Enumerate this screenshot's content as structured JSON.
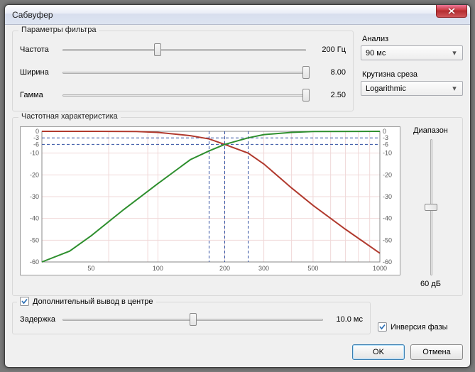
{
  "window": {
    "title": "Сабвуфер"
  },
  "filter": {
    "group": "Параметры фильтра",
    "freq_label": "Частота",
    "freq_value": "200 Гц",
    "freq_pos": 39,
    "width_label": "Ширина",
    "width_value": "8.00",
    "width_pos": 100,
    "gamma_label": "Гамма",
    "gamma_value": "2.50",
    "gamma_pos": 100
  },
  "analysis": {
    "label": "Анализ",
    "value": "90 мс"
  },
  "slope": {
    "label": "Крутизна среза",
    "value": "Logarithmic"
  },
  "response": {
    "group": "Частотная характеристика"
  },
  "range": {
    "label": "Диапазон",
    "value": "60 дБ",
    "pos": 50
  },
  "delay": {
    "chk_label": "Дополнительный вывод в центре",
    "chk_checked": true,
    "label": "Задержка",
    "value": "10.0 мс",
    "pos": 50
  },
  "invert": {
    "label": "Инверсия фазы",
    "checked": true
  },
  "buttons": {
    "ok": "OK",
    "cancel": "Отмена"
  },
  "colors": {
    "grid_minor": "#F0D8D8",
    "grid_major": "#D0D0D0",
    "axis_text": "#555555",
    "curve_low": "#B13A2E",
    "curve_high": "#2E8F2E",
    "marker": "#2F4EA0"
  },
  "chart_data": {
    "type": "line",
    "xscale": "log",
    "xlim": [
      30,
      1000
    ],
    "ylim": [
      -60,
      0
    ],
    "xticks": [
      50,
      100,
      200,
      300,
      500,
      1000
    ],
    "yticks_left": [
      0,
      -3,
      -6,
      -10,
      -20,
      -30,
      -40,
      -50,
      -60
    ],
    "yticks_right": [
      0,
      -3,
      -6,
      -10,
      -20,
      -30,
      -40,
      -50,
      -60
    ],
    "crossover_hz": 200,
    "crossover_db": -6,
    "side_markers_hz": [
      170,
      255
    ],
    "series": [
      {
        "name": "lowpass",
        "color": "#B13A2E",
        "points": [
          {
            "hz": 30,
            "db": 0.0
          },
          {
            "hz": 50,
            "db": 0.0
          },
          {
            "hz": 80,
            "db": -0.1
          },
          {
            "hz": 100,
            "db": -0.5
          },
          {
            "hz": 140,
            "db": -2.0
          },
          {
            "hz": 170,
            "db": -3.5
          },
          {
            "hz": 200,
            "db": -6.0
          },
          {
            "hz": 255,
            "db": -10.0
          },
          {
            "hz": 300,
            "db": -15.0
          },
          {
            "hz": 400,
            "db": -26.0
          },
          {
            "hz": 500,
            "db": -34.0
          },
          {
            "hz": 700,
            "db": -45.0
          },
          {
            "hz": 1000,
            "db": -56.0
          }
        ]
      },
      {
        "name": "highpass",
        "color": "#2E8F2E",
        "points": [
          {
            "hz": 30,
            "db": -60.0
          },
          {
            "hz": 40,
            "db": -55.0
          },
          {
            "hz": 50,
            "db": -48.0
          },
          {
            "hz": 70,
            "db": -36.0
          },
          {
            "hz": 100,
            "db": -24.0
          },
          {
            "hz": 140,
            "db": -13.0
          },
          {
            "hz": 170,
            "db": -9.0
          },
          {
            "hz": 200,
            "db": -6.0
          },
          {
            "hz": 255,
            "db": -3.0
          },
          {
            "hz": 300,
            "db": -1.5
          },
          {
            "hz": 400,
            "db": -0.5
          },
          {
            "hz": 500,
            "db": -0.1
          },
          {
            "hz": 1000,
            "db": 0.0
          }
        ]
      }
    ]
  }
}
